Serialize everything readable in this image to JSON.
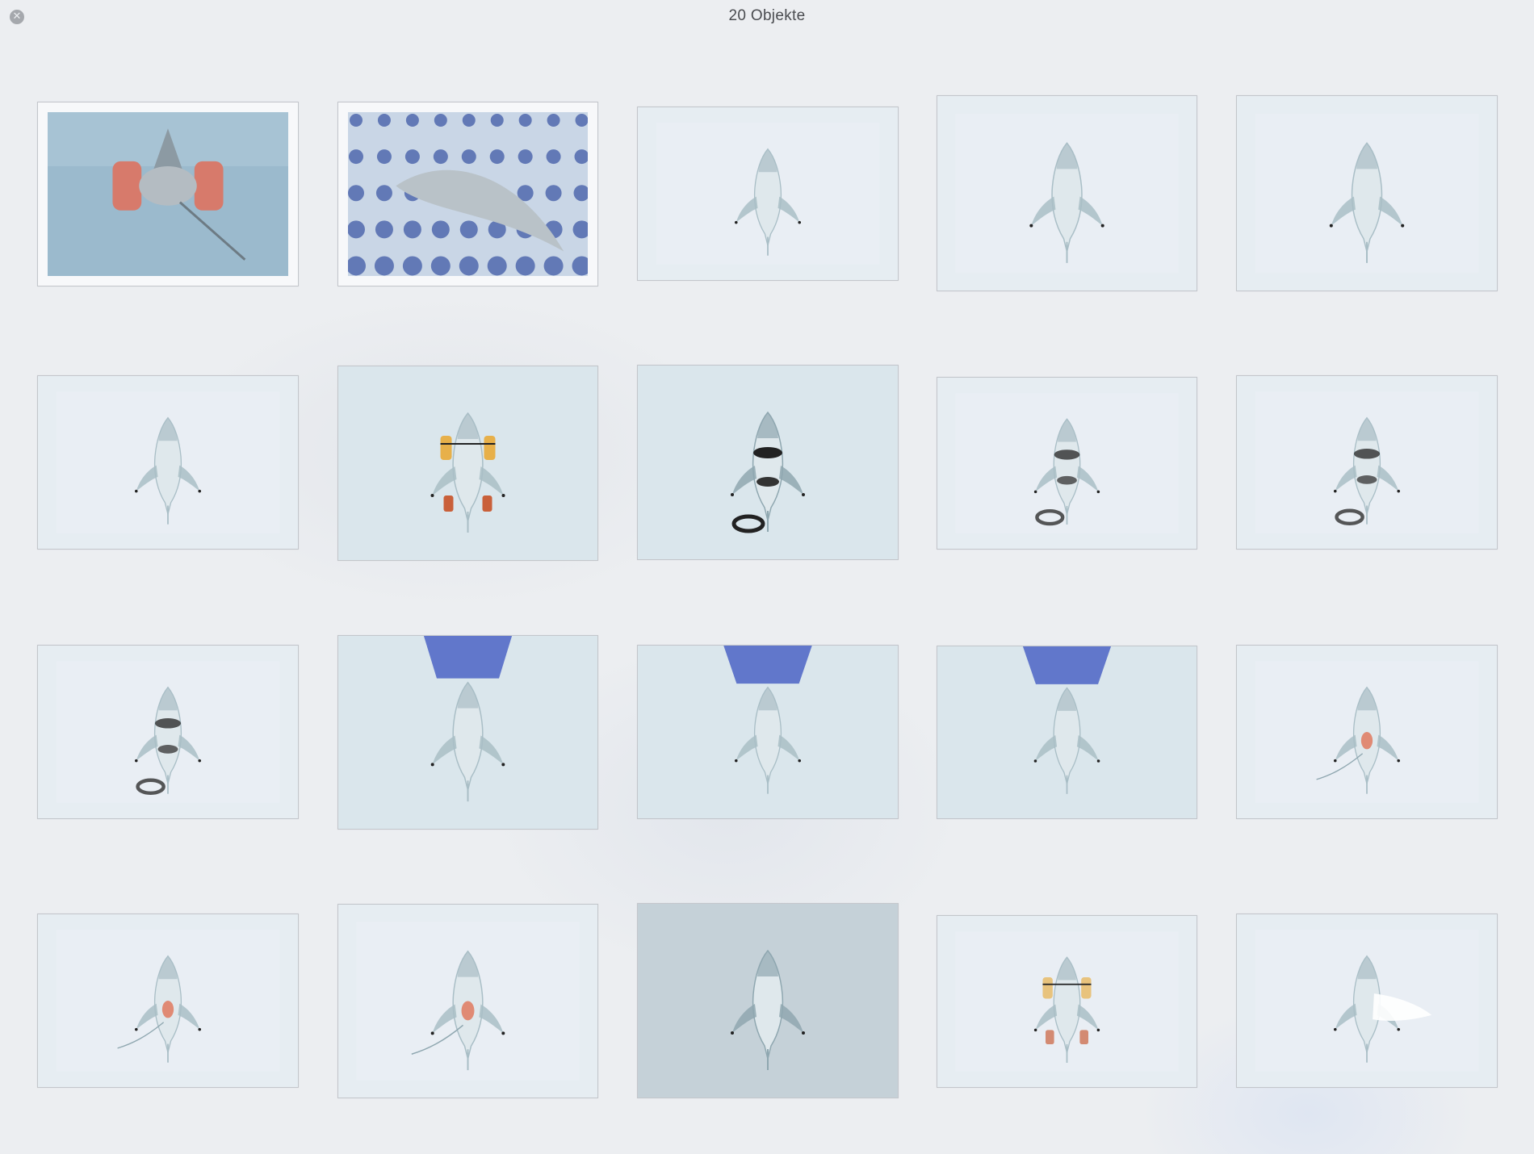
{
  "window": {
    "title": "20 Objekte",
    "close_icon": "close-icon"
  },
  "grid": {
    "item_count": 20,
    "items": [
      {
        "variant": "water"
      },
      {
        "variant": "pattern"
      },
      {
        "variant": "plain"
      },
      {
        "variant": "plain"
      },
      {
        "variant": "plain"
      },
      {
        "variant": "plain"
      },
      {
        "variant": "floaties"
      },
      {
        "variant": "rings"
      },
      {
        "variant": "rings-light"
      },
      {
        "variant": "rings-light"
      },
      {
        "variant": "rings-light"
      },
      {
        "variant": "blue-top"
      },
      {
        "variant": "blue-top"
      },
      {
        "variant": "blue-top"
      },
      {
        "variant": "red"
      },
      {
        "variant": "red"
      },
      {
        "variant": "red"
      },
      {
        "variant": "plain-dark"
      },
      {
        "variant": "floaties-light"
      },
      {
        "variant": "white"
      }
    ]
  }
}
